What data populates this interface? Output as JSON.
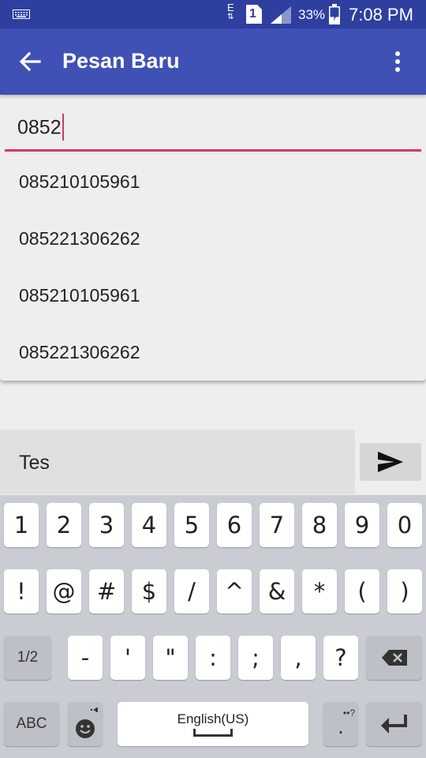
{
  "status_bar": {
    "network_label": "E",
    "sim_label": "1",
    "battery_percent": "33%",
    "time": "7:08 PM"
  },
  "app_bar": {
    "title": "Pesan Baru",
    "back_icon": "arrow-left-icon",
    "menu_icon": "more-vert-icon"
  },
  "recipient": {
    "value": "0852"
  },
  "suggestions": [
    "085210105961",
    "085221306262",
    "085210105961",
    "085221306262"
  ],
  "compose": {
    "message": "Tes",
    "send_icon": "send-icon"
  },
  "keyboard": {
    "row1": [
      "1",
      "2",
      "3",
      "4",
      "5",
      "6",
      "7",
      "8",
      "9",
      "0"
    ],
    "row2": [
      "!",
      "@",
      "#",
      "$",
      "/",
      "^",
      "&",
      "*",
      "(",
      ")"
    ],
    "row3_left": "1/2",
    "row3": [
      "-",
      "'",
      "\"",
      ":",
      ";",
      ",",
      "?"
    ],
    "abc_label": "ABC",
    "space_label": "English(US)",
    "punct_label": ".",
    "colors": {
      "accent": "#d8336b",
      "appbar": "#3f51b5",
      "statusbar": "#2f3fa0"
    }
  }
}
